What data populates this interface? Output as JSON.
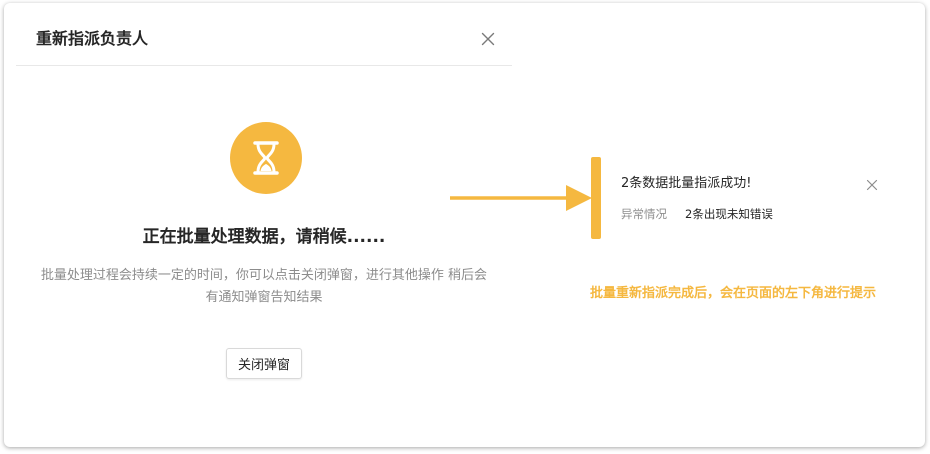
{
  "modal": {
    "title": "重新指派负责人",
    "loading_title": "正在批量处理数据，请稍候......",
    "loading_desc": "批量处理过程会持续一定的时间，你可以点击关闭弹窗，进行其他操作 稍后会有通知弹窗告知结果",
    "close_button_label": "关闭弹窗",
    "icon": "hourglass-icon"
  },
  "notification": {
    "title": "2条数据批量指派成功!",
    "label": "异常情况",
    "value": "2条出现未知错误"
  },
  "caption": "批量重新指派完成后，会在页面的左下角进行提示",
  "colors": {
    "accent": "#f5b840",
    "text_primary": "#262626",
    "text_secondary": "#8c8c8c",
    "divider": "#e8e8e8"
  }
}
